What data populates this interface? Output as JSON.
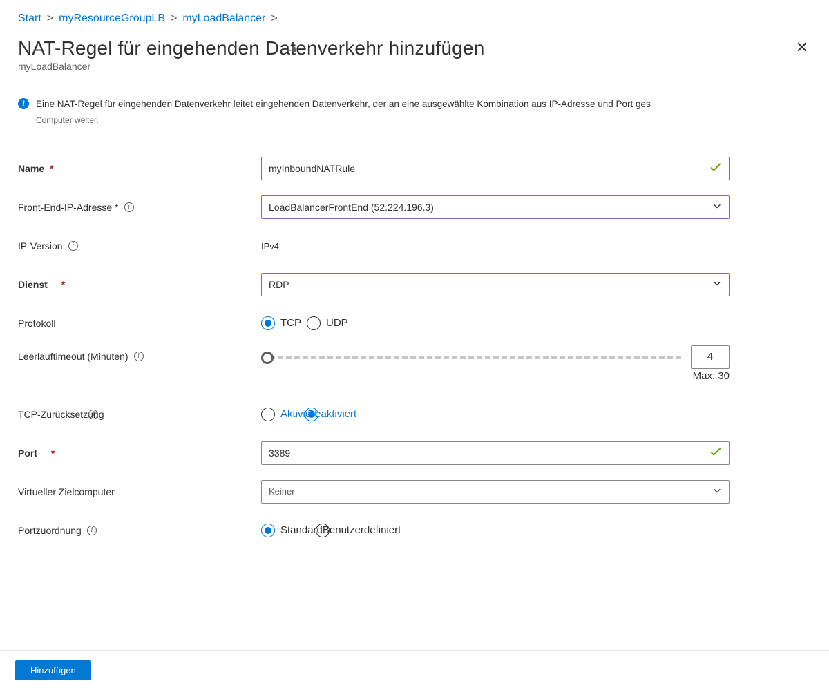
{
  "breadcrumb": {
    "start": "Start",
    "group": "myResourceGroupLB",
    "resource": "myLoadBalancer"
  },
  "header": {
    "title": "NAT-Regel für eingehenden Datenverkehr hinzufügen",
    "subtitle": "myLoadBalancer"
  },
  "info": {
    "line1": "Eine NAT-Regel für eingehenden Datenverkehr leitet eingehenden Datenverkehr, der an eine ausgewählte Kombination aus IP-Adresse und Port ges",
    "line2": "Computer weiter."
  },
  "form": {
    "name_label": "Name",
    "name_value": "myInboundNATRule",
    "frontend_label": "Front-End-IP-Adresse *",
    "frontend_value": "LoadBalancerFrontEnd (52.224.196.3)",
    "ipversion_label": "IP-Version",
    "ipversion_value": "IPv4",
    "service_label": "Dienst",
    "service_value": "RDP",
    "protocol_label": "Protokoll",
    "protocol_tcp": "TCP",
    "protocol_udp": "UDP",
    "protocol_selected": "TCP",
    "idle_label": "Leerlauftimeout (Minuten)",
    "idle_value": "4",
    "idle_max": "Max: 30",
    "tcpreset_label": "TCP-Zurücksetzung",
    "tcpreset_enabled": "Aktiviert",
    "tcpreset_disabled": "Deaktiviert",
    "tcpreset_selected": "Deaktiviert",
    "port_label": "Port",
    "port_value": "3389",
    "targetvm_label": "Virtueller Zielcomputer",
    "targetvm_value": "Keiner",
    "portmap_label": "Portzuordnung",
    "portmap_default": "Standard",
    "portmap_custom": "Benutzerdefiniert",
    "portmap_selected": "Standard"
  },
  "footer": {
    "add": "Hinzufügen"
  }
}
